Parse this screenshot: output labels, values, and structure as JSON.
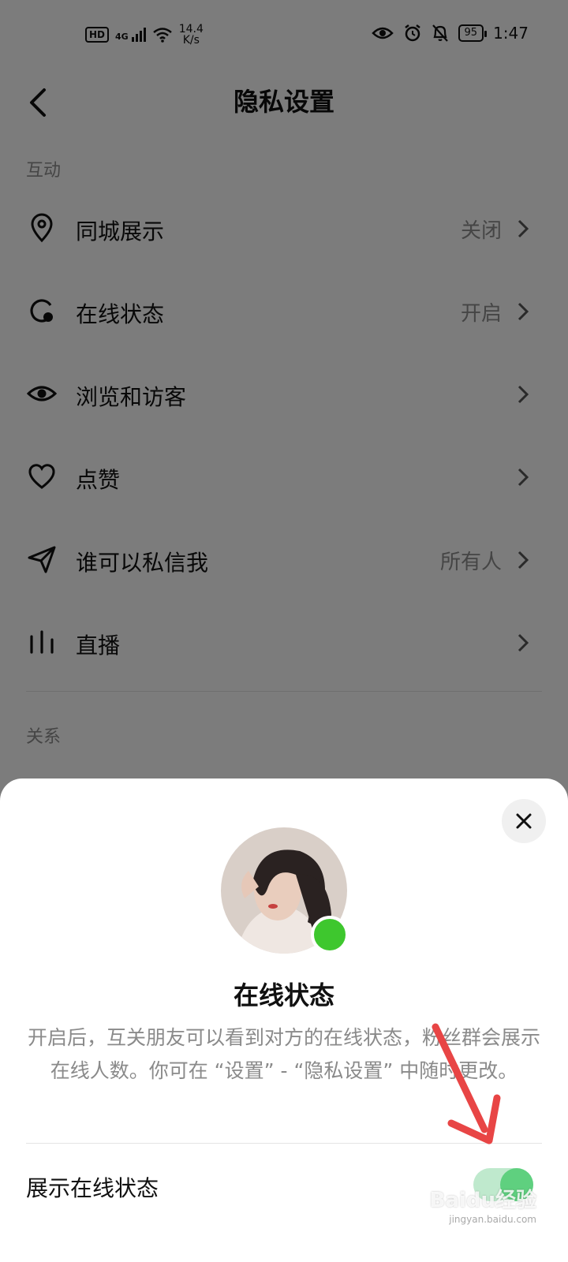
{
  "status_bar": {
    "hd": "HD",
    "network": "4G",
    "speed_value": "14.4",
    "speed_unit": "K/s",
    "battery": "95",
    "time": "1:47"
  },
  "header": {
    "title": "隐私设置"
  },
  "sections": {
    "interaction_label": "互动",
    "relation_label": "关系"
  },
  "rows": [
    {
      "label": "同城展示",
      "value": "关闭",
      "icon": "location-pin-icon"
    },
    {
      "label": "在线状态",
      "value": "开启",
      "icon": "online-status-icon"
    },
    {
      "label": "浏览和访客",
      "value": "",
      "icon": "eye-icon"
    },
    {
      "label": "点赞",
      "value": "",
      "icon": "heart-icon"
    },
    {
      "label": "谁可以私信我",
      "value": "所有人",
      "icon": "send-icon"
    },
    {
      "label": "直播",
      "value": "",
      "icon": "live-bars-icon"
    }
  ],
  "sheet": {
    "title": "在线状态",
    "description": "开启后，互关朋友可以看到对方的在线状态，粉丝群会展示在线人数。你可在 “设置” - “隐私设置” 中随时更改。",
    "toggle_label": "展示在线状态",
    "toggle_on": true
  },
  "watermark": {
    "text": "Baidu经验",
    "sub": "jingyan.baidu.com"
  },
  "colors": {
    "online_green": "#3ec72e",
    "toggle_green": "#5fd07f",
    "arrow_red": "#e84545"
  }
}
